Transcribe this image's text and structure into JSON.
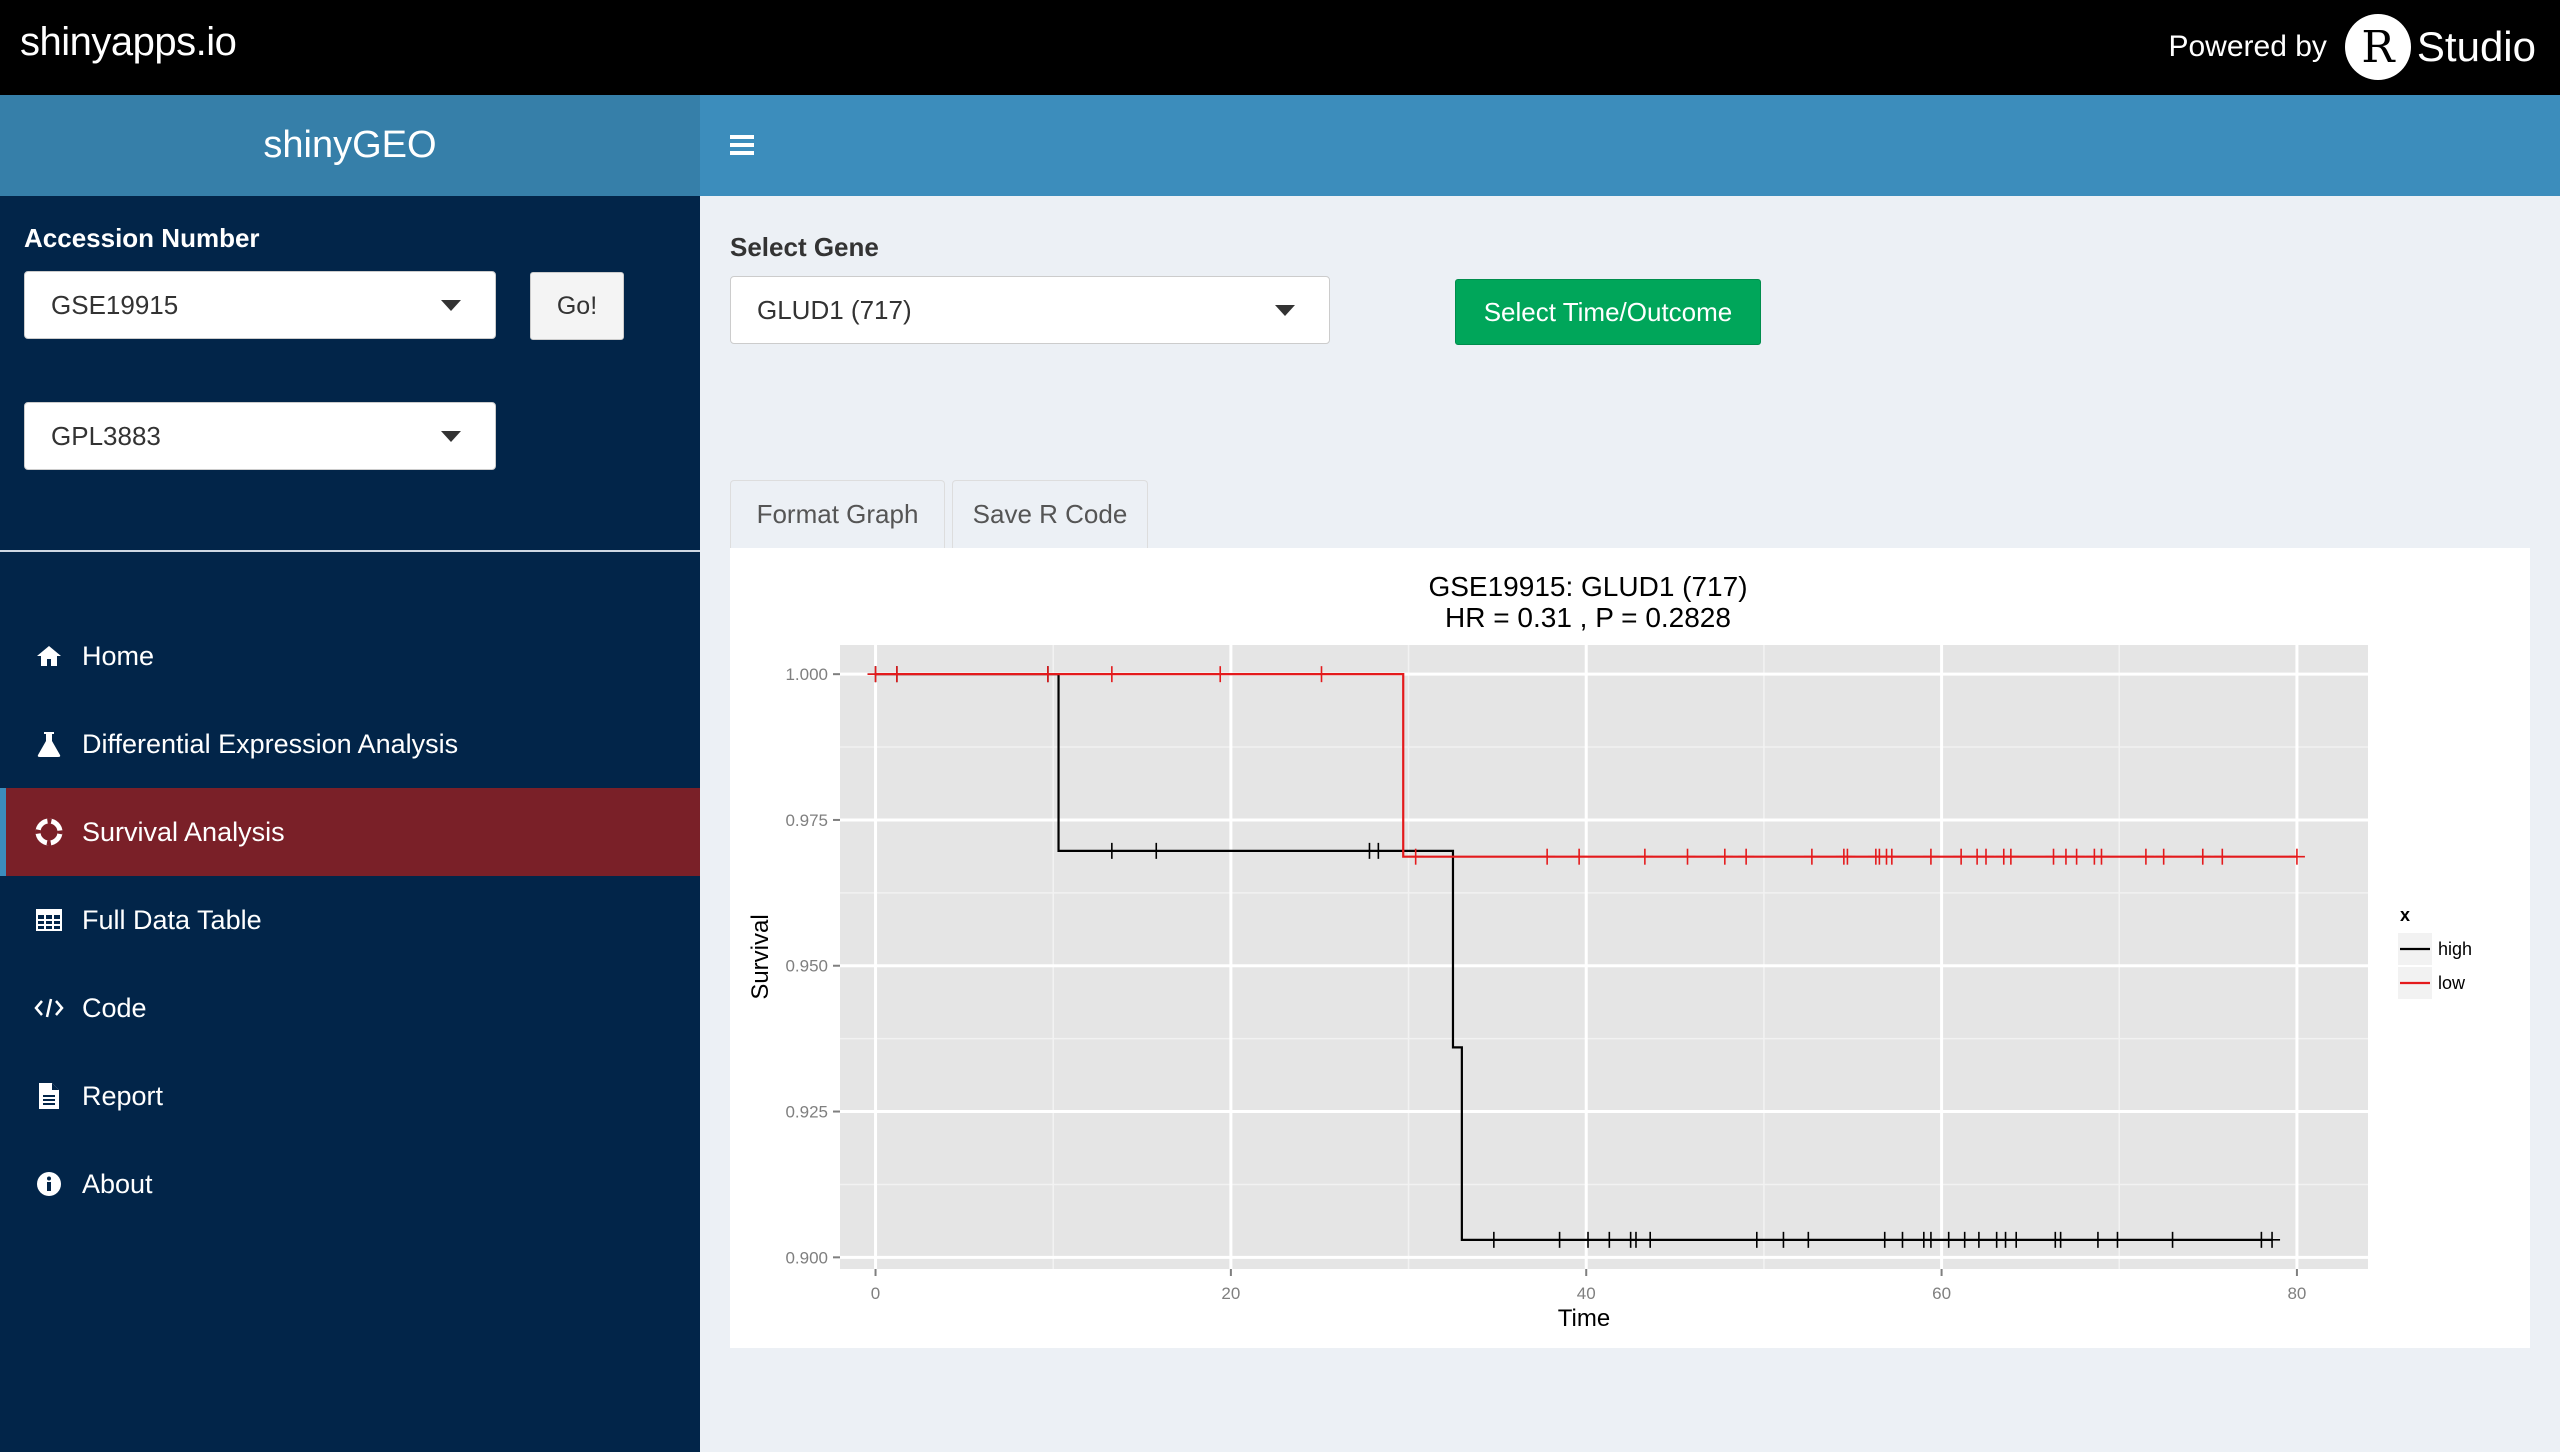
{
  "topbar": {
    "brand": "shinyapps.io",
    "powered_by": "Powered by",
    "r_letter": "R",
    "studio": "Studio"
  },
  "sidebar": {
    "app_title": "shinyGEO",
    "accession_label": "Accession Number",
    "accession_value": "GSE19915",
    "go_label": "Go!",
    "platform_value": "GPL3883",
    "menu": [
      {
        "label": "Home",
        "icon": "home-icon",
        "active": false
      },
      {
        "label": "Differential Expression Analysis",
        "icon": "flask-icon",
        "active": false
      },
      {
        "label": "Survival Analysis",
        "icon": "life-ring-icon",
        "active": true
      },
      {
        "label": "Full Data Table",
        "icon": "table-icon",
        "active": false
      },
      {
        "label": "Code",
        "icon": "code-icon",
        "active": false
      },
      {
        "label": "Report",
        "icon": "file-text-icon",
        "active": false
      },
      {
        "label": "About",
        "icon": "info-circle-icon",
        "active": false
      }
    ]
  },
  "main": {
    "select_gene_label": "Select Gene",
    "gene_value": "GLUD1 (717)",
    "time_outcome_button": "Select Time/Outcome",
    "tabs": [
      "Format Graph",
      "Save R Code"
    ]
  },
  "colors": {
    "topbar": "#000000",
    "sidebar": "#022549",
    "header": "#3c8dbc",
    "active_menu": "#7a2028",
    "button_green": "#00a65a",
    "high": "#000000",
    "low": "#e41a1c"
  },
  "chart_data": {
    "type": "line",
    "title": "GSE19915: GLUD1 (717)",
    "subtitle": "HR =  0.31 , P = 0.2828",
    "xlabel": "Time",
    "ylabel": "Survival",
    "xlim": [
      -2,
      84
    ],
    "ylim": [
      0.898,
      1.005
    ],
    "x_ticks": [
      "0",
      "20",
      "40",
      "60",
      "80"
    ],
    "y_ticks": [
      "0.900",
      "0.925",
      "0.950",
      "0.975",
      "1.000"
    ],
    "grid": true,
    "legend_title": "x",
    "legend_placement": "right",
    "series": [
      {
        "name": "high",
        "color": "#000000",
        "steps": [
          [
            0,
            1.0
          ],
          [
            10.3,
            0.9697
          ],
          [
            32.5,
            0.936
          ],
          [
            33.0,
            0.903
          ],
          [
            78.6,
            0.903
          ]
        ],
        "censor": [
          0,
          1.2,
          9.7,
          13.3,
          15.8,
          27.8,
          28.3,
          34.8,
          38.5,
          40.1,
          41.3,
          42.5,
          42.8,
          43.6,
          49.6,
          51.1,
          52.5,
          56.8,
          57.8,
          59.0,
          59.4,
          60.4,
          61.3,
          62.1,
          63.1,
          63.6,
          64.2,
          66.4,
          66.7,
          68.8,
          69.9,
          73.0,
          78.0,
          78.6
        ]
      },
      {
        "name": "low",
        "color": "#e41a1c",
        "steps": [
          [
            0,
            1.0
          ],
          [
            29.7,
            0.9687
          ],
          [
            80.0,
            0.9687
          ]
        ],
        "censor": [
          0,
          1.2,
          9.7,
          13.3,
          19.4,
          25.1,
          30.4,
          37.8,
          39.6,
          43.3,
          45.7,
          47.8,
          49.0,
          52.7,
          54.5,
          54.7,
          56.3,
          56.5,
          56.9,
          57.2,
          59.4,
          61.1,
          62.0,
          62.5,
          63.5,
          63.9,
          66.3,
          67.0,
          67.6,
          68.6,
          69.0,
          71.5,
          72.5,
          74.7,
          75.8,
          80.0
        ]
      }
    ]
  }
}
